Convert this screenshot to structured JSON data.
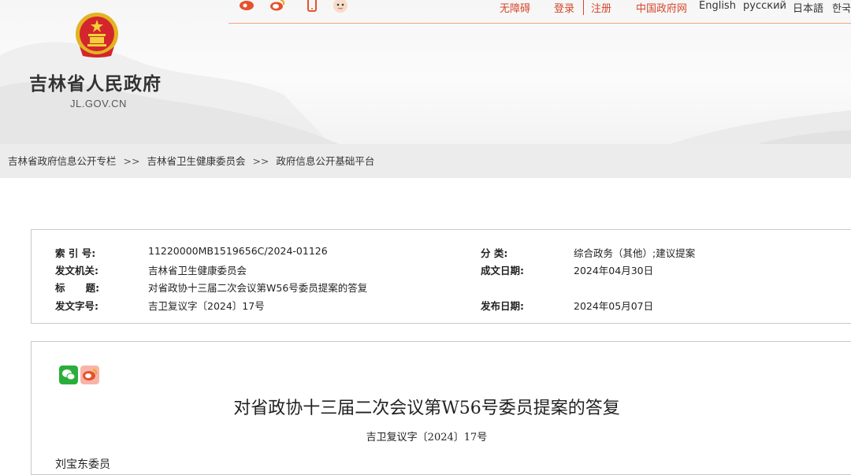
{
  "header": {
    "site_title": "吉林省人民政府",
    "site_domain": "JL.GOV.CN",
    "top_icons": [
      "weibo-red-icon",
      "weibo-icon",
      "mobile-icon",
      "robot-assistant-icon"
    ],
    "top_links": {
      "accessibility": "无障碍",
      "login": "登录",
      "register": "注册",
      "china_gov": "中国政府网",
      "english": "English",
      "russian": "русский",
      "japanese": "日本語",
      "korean": "한국"
    },
    "accent_color": "#d5482c"
  },
  "breadcrumb": {
    "items": [
      "吉林省政府信息公开专栏",
      "吉林省卫生健康委员会",
      "政府信息公开基础平台"
    ],
    "separator": ">>"
  },
  "info": {
    "index_label": "索 引 号:",
    "index_value": "11220000MB1519656C/2024-01126",
    "category_label": "分    类:",
    "category_value": "综合政务（其他）;建议提案",
    "issuer_label": "发文机关:",
    "issuer_value": "吉林省卫生健康委员会",
    "created_label": "成文日期:",
    "created_value": "2024年04月30日",
    "title_label": "标      题:",
    "title_value": "对省政协十三届二次会议第W56号委员提案的答复",
    "docno_label": "发文字号:",
    "docno_value": "吉卫复议字〔2024〕17号",
    "published_label": "发布日期:",
    "published_value": "2024年05月07日"
  },
  "article": {
    "share_icons": [
      "wechat-share-icon",
      "weibo-share-icon"
    ],
    "title": "对省政协十三届二次会议第W56号委员提案的答复",
    "doc_number": "吉卫复议字〔2024〕17号",
    "first_line": "刘宝东委员"
  }
}
